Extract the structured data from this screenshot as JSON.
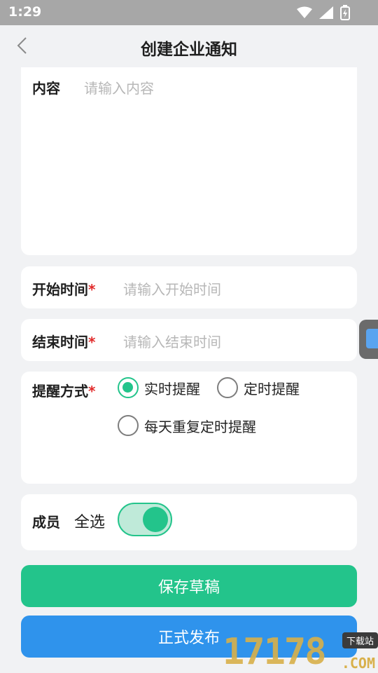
{
  "status_bar": {
    "time": "1:29"
  },
  "header": {
    "title": "创建企业通知"
  },
  "content": {
    "label": "内容",
    "placeholder": "请输入内容"
  },
  "start_time": {
    "label": "开始时间",
    "required_mark": "*",
    "placeholder": "请输入开始时间"
  },
  "end_time": {
    "label": "结束时间",
    "required_mark": "*",
    "placeholder": "请输入结束时间"
  },
  "reminder": {
    "label": "提醒方式",
    "required_mark": "*",
    "options": [
      {
        "label": "实时提醒",
        "checked": true
      },
      {
        "label": "定时提醒",
        "checked": false
      },
      {
        "label": "每天重复定时提醒",
        "checked": false
      }
    ]
  },
  "members": {
    "label": "成员",
    "select_all_label": "全选",
    "select_all_on": true
  },
  "buttons": {
    "save_draft": "保存草稿",
    "publish": "正式发布"
  },
  "watermark": {
    "digits": "17178",
    "domain": ".COM",
    "tag": "下载站"
  },
  "colors": {
    "accent_green": "#23c48b",
    "accent_blue": "#2f93ec",
    "required_red": "#e12a2a"
  }
}
